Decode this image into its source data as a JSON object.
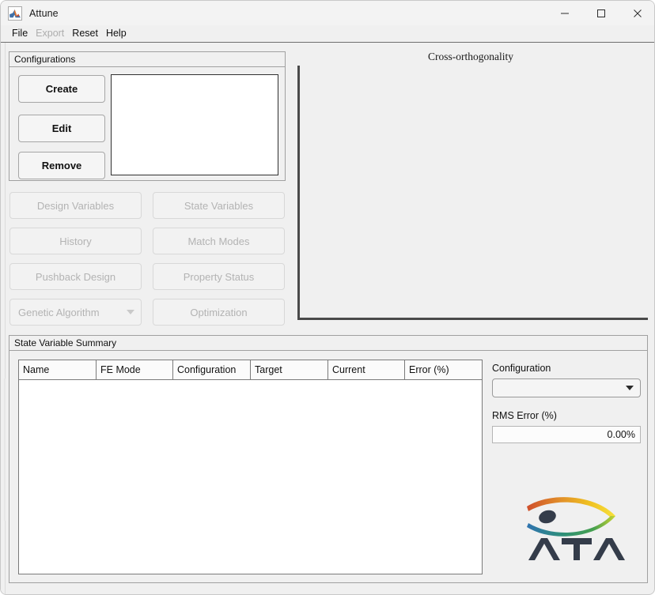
{
  "window": {
    "title": "Attune",
    "icon": "matlab-app-icon",
    "controls": {
      "minimize": "—",
      "maximize": "□",
      "close": "✕"
    }
  },
  "menubar": {
    "items": [
      {
        "label": "File",
        "disabled": false
      },
      {
        "label": "Export",
        "disabled": true
      },
      {
        "label": "Reset",
        "disabled": false
      },
      {
        "label": "Help",
        "disabled": false
      }
    ]
  },
  "configurations": {
    "panel_title": "Configurations",
    "buttons": [
      {
        "label": "Create"
      },
      {
        "label": "Edit"
      },
      {
        "label": "Remove"
      }
    ],
    "listbox_items": []
  },
  "actions": {
    "buttons": [
      {
        "label": "Design Variables",
        "disabled": true
      },
      {
        "label": "State Variables",
        "disabled": true
      },
      {
        "label": "History",
        "disabled": true
      },
      {
        "label": "Match Modes",
        "disabled": true
      },
      {
        "label": "Pushback Design",
        "disabled": true
      },
      {
        "label": "Property Status",
        "disabled": true
      },
      {
        "label": "Optimization",
        "disabled": true
      }
    ],
    "solver_dropdown": {
      "value": "Genetic Algorithm",
      "disabled": true,
      "caret": "chevron-down-icon"
    }
  },
  "plot": {
    "title": "Cross-orthogonality",
    "axis_color": "#4a4a4a",
    "has_data": false
  },
  "state_variable_summary": {
    "panel_title": "State Variable Summary",
    "columns": [
      {
        "label": "Name",
        "width": 98
      },
      {
        "label": "FE Mode",
        "width": 97
      },
      {
        "label": "Configuration",
        "width": 98
      },
      {
        "label": "Target",
        "width": 98
      },
      {
        "label": "Current",
        "width": 97
      },
      {
        "label": "Error (%)",
        "width": 97
      }
    ],
    "rows": [],
    "configuration_select": {
      "label": "Configuration",
      "value": "",
      "options": []
    },
    "rms_error": {
      "label": "RMS Error (%)",
      "value": "0.00%"
    }
  },
  "branding": {
    "logo_name": "ata-logo",
    "wordmark": "ATA",
    "colors": {
      "orange": "#d9542b",
      "yellow": "#f2c413",
      "green": "#3e9b52",
      "blue": "#2f73b0",
      "dark": "#343c4a"
    }
  }
}
